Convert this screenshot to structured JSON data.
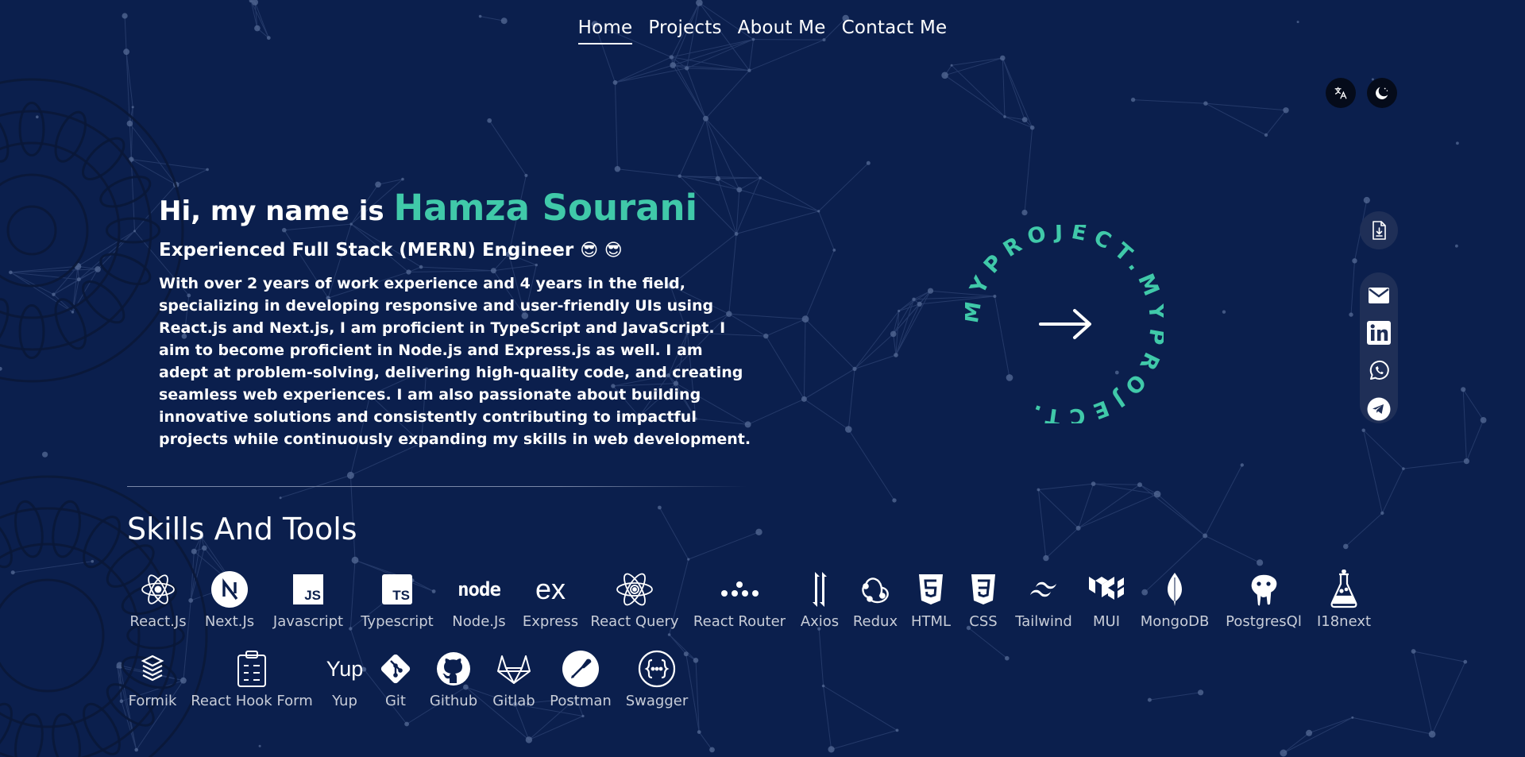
{
  "nav": {
    "items": [
      {
        "label": "Home",
        "active": true
      },
      {
        "label": "Projects",
        "active": false
      },
      {
        "label": "About Me",
        "active": false
      },
      {
        "label": "Contact Me",
        "active": false
      }
    ]
  },
  "top_controls": {
    "translate_icon": "translate-icon",
    "theme_icon": "moon-icon"
  },
  "hero": {
    "greeting": "Hi, my name is",
    "name": "Hamza Sourani",
    "role": "Experienced Full Stack (MERN) Engineer",
    "role_emojis": "😎 😎",
    "bio": "With over 2 years of work experience and 4 years in the field, specializing in developing responsive and user-friendly UIs using React.js and Next.js, I am proficient in TypeScript and JavaScript. I aim to become proficient in Node.js and Express.js as well. I am adept at problem-solving, delivering high-quality code, and creating seamless web experiences. I am also passionate about building innovative solutions and consistently contributing to impactful projects while continuously expanding my skills in web development."
  },
  "cta": {
    "circle_text": "MYPROJECT.MYPROJECT.",
    "icon": "arrow-right-icon"
  },
  "social": {
    "resume_icon": "resume-download-icon",
    "items": [
      "mail-icon",
      "linkedin-icon",
      "whatsapp-icon",
      "telegram-icon"
    ]
  },
  "skills": {
    "title": "Skills And Tools",
    "row1": [
      "React.Js",
      "Next.Js",
      "Javascript",
      "Typescript",
      "Node.Js",
      "Express",
      "React Query",
      "React Router",
      "Axios",
      "Redux",
      "HTML",
      "CSS",
      "Tailwind",
      "MUI",
      "MongoDB",
      "PostgresQl",
      "I18next"
    ],
    "row2": [
      "Formik",
      "React Hook Form",
      "Yup",
      "Git",
      "Github",
      "Gitlab",
      "Postman",
      "Swagger"
    ],
    "icon_text": {
      "js": "JS",
      "ts": "TS",
      "node": "node",
      "express": "ex",
      "yup": "Yup"
    }
  },
  "colors": {
    "background": "#0b1f4d",
    "accent": "#40c9a9",
    "text": "#ffffff",
    "muted": "#c8cdd8"
  }
}
